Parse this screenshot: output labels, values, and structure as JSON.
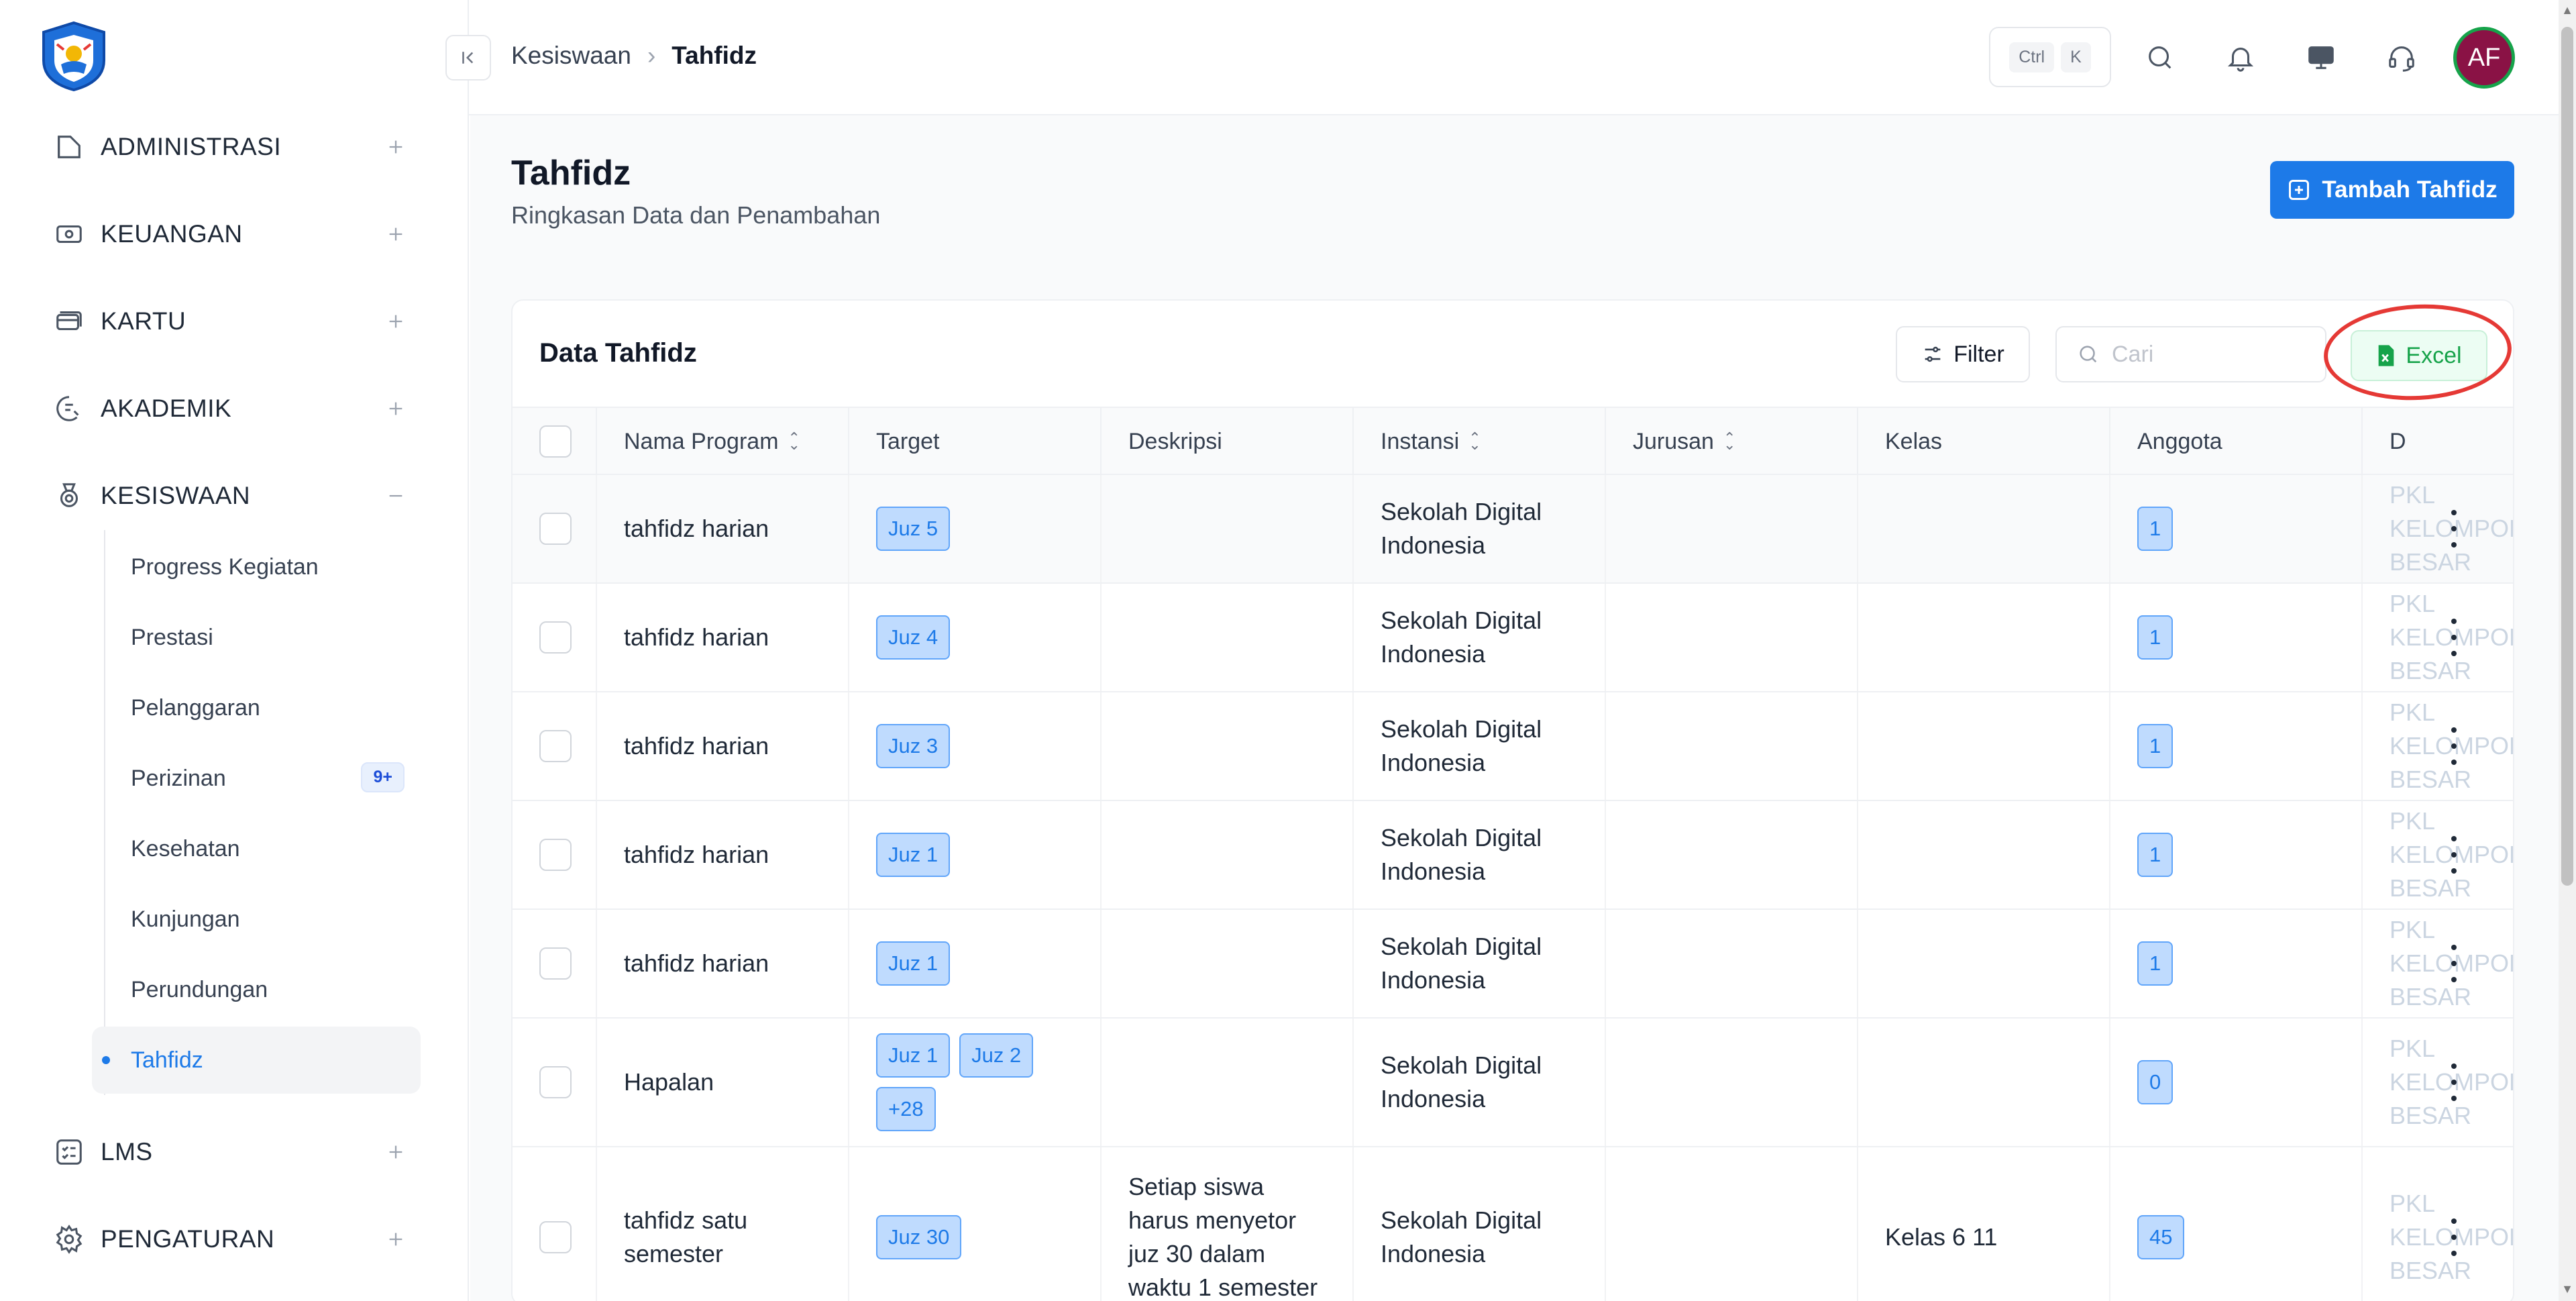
{
  "sidebar": {
    "menu": [
      {
        "label": "ADMINISTRASI",
        "icon": "folder-icon",
        "toggle": "+"
      },
      {
        "label": "KEUANGAN",
        "icon": "money-icon",
        "toggle": "+"
      },
      {
        "label": "KARTU",
        "icon": "card-icon",
        "toggle": "+"
      },
      {
        "label": "AKADEMIK",
        "icon": "academic-icon",
        "toggle": "+"
      },
      {
        "label": "KESISWAAN",
        "icon": "medal-icon",
        "toggle": "−"
      },
      {
        "label": "LMS",
        "icon": "checklist-icon",
        "toggle": "+"
      },
      {
        "label": "PENGATURAN",
        "icon": "gear-icon",
        "toggle": "+"
      }
    ],
    "submenu": [
      {
        "label": "Progress Kegiatan"
      },
      {
        "label": "Prestasi"
      },
      {
        "label": "Pelanggaran"
      },
      {
        "label": "Perizinan",
        "badge": "9+"
      },
      {
        "label": "Kesehatan"
      },
      {
        "label": "Kunjungan"
      },
      {
        "label": "Perundungan"
      },
      {
        "label": "Tahfidz"
      }
    ]
  },
  "topbar": {
    "breadcrumb": {
      "parent": "Kesiswaan",
      "separator": "›",
      "current": "Tahfidz"
    },
    "shortcut": {
      "key1": "Ctrl",
      "key2": "K"
    },
    "avatar_initials": "AF"
  },
  "page": {
    "title": "Tahfidz",
    "subtitle": "Ringkasan Data dan Penambahan",
    "add_button": "Tambah Tahfidz"
  },
  "card": {
    "title": "Data Tahfidz",
    "filter_label": "Filter",
    "search_placeholder": "Cari",
    "excel_label": "Excel"
  },
  "table": {
    "columns": [
      "Nama Program",
      "Target",
      "Deskripsi",
      "Instansi",
      "Jurusan",
      "Kelas",
      "Anggota",
      "D"
    ],
    "rows": [
      {
        "nama": "tahfidz harian",
        "targets": [
          "Juz 5"
        ],
        "deskripsi": "",
        "instansi": "Sekolah Digital Indonesia",
        "jurusan": "",
        "kelas": "",
        "anggota": "1",
        "extra": "PKL KELOMPOK BESAR"
      },
      {
        "nama": "tahfidz harian",
        "targets": [
          "Juz 4"
        ],
        "deskripsi": "",
        "instansi": "Sekolah Digital Indonesia",
        "jurusan": "",
        "kelas": "",
        "anggota": "1",
        "extra": "PKL KELOMPOK BESAR"
      },
      {
        "nama": "tahfidz harian",
        "targets": [
          "Juz 3"
        ],
        "deskripsi": "",
        "instansi": "Sekolah Digital Indonesia",
        "jurusan": "",
        "kelas": "",
        "anggota": "1",
        "extra": "PKL KELOMPOK BESAR"
      },
      {
        "nama": "tahfidz harian",
        "targets": [
          "Juz 1"
        ],
        "deskripsi": "",
        "instansi": "Sekolah Digital Indonesia",
        "jurusan": "",
        "kelas": "",
        "anggota": "1",
        "extra": "PKL KELOMPOK BESAR"
      },
      {
        "nama": "tahfidz harian",
        "targets": [
          "Juz 1"
        ],
        "deskripsi": "",
        "instansi": "Sekolah Digital Indonesia",
        "jurusan": "",
        "kelas": "",
        "anggota": "1",
        "extra": "PKL KELOMPOK BESAR"
      },
      {
        "nama": "Hapalan",
        "targets": [
          "Juz 1",
          "Juz 2",
          "+28"
        ],
        "deskripsi": "",
        "instansi": "Sekolah Digital Indonesia",
        "jurusan": "",
        "kelas": "",
        "anggota": "0",
        "extra": "PKL KELOMPOK BESAR"
      },
      {
        "nama": "tahfidz satu semester",
        "targets": [
          "Juz 30"
        ],
        "deskripsi": "Setiap siswa harus menyetor juz 30 dalam waktu 1 semester",
        "instansi": "Sekolah Digital Indonesia",
        "jurusan": "",
        "kelas": "Kelas 6 11",
        "anggota": "45",
        "extra": "PKL KELOMPOK BESAR"
      }
    ]
  },
  "colors": {
    "accent": "#1d7ae8",
    "excel": "#16a34a",
    "annotation": "#e53935"
  }
}
